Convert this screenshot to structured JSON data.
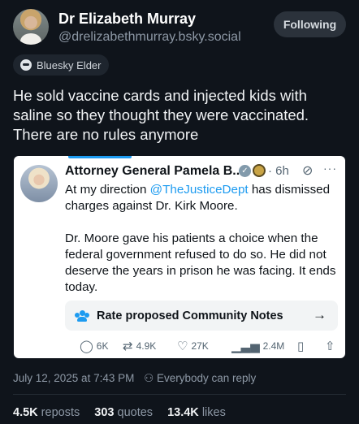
{
  "author": {
    "name": "Dr Elizabeth Murray",
    "handle": "@drelizabethmurray.bsky.social",
    "follow_label": "Following",
    "badge": "Bluesky Elder"
  },
  "post": {
    "text": "He sold vaccine cards and injected kids with saline so they thought they were vaccinated. There are no rules anymore"
  },
  "quote": {
    "name": "Attorney General Pamela B...",
    "time": "· 6h",
    "body_line1_prefix": "At my direction ",
    "body_mention": "@TheJusticeDept",
    "body_line1_suffix": " has dismissed charges against Dr. Kirk Moore.",
    "body_paragraph2": "Dr. Moore gave his patients a choice when the federal government refused to do so. He did not deserve the years in prison he was facing. It ends today.",
    "community_notes_label": "Rate proposed Community Notes",
    "actions": {
      "replies": "6K",
      "reposts": "4.9K",
      "likes": "27K",
      "views": "2.4M"
    }
  },
  "meta": {
    "timestamp": "July 12, 2025 at 7:43 PM",
    "reply_setting": "Everybody can reply"
  },
  "stats": {
    "reposts_count": "4.5K",
    "reposts_label": "reposts",
    "quotes_count": "303",
    "quotes_label": "quotes",
    "likes_count": "13.4K",
    "likes_label": "likes"
  },
  "icons": {
    "badge": "bluesky-elder-icon",
    "verified": "verified-badge-icon",
    "seal": "government-seal-icon",
    "grok": "grok-icon",
    "more": "more-icon",
    "notes": "community-notes-icon",
    "arrow": "arrow-right-icon",
    "reply": "reply-icon",
    "repost": "repost-icon",
    "like": "heart-icon",
    "views": "views-icon",
    "bookmark": "bookmark-icon",
    "share": "share-icon",
    "people": "people-icon"
  },
  "colors": {
    "background": "#0f141b",
    "accent": "#1d9bf0",
    "muted": "#8d98a5"
  }
}
